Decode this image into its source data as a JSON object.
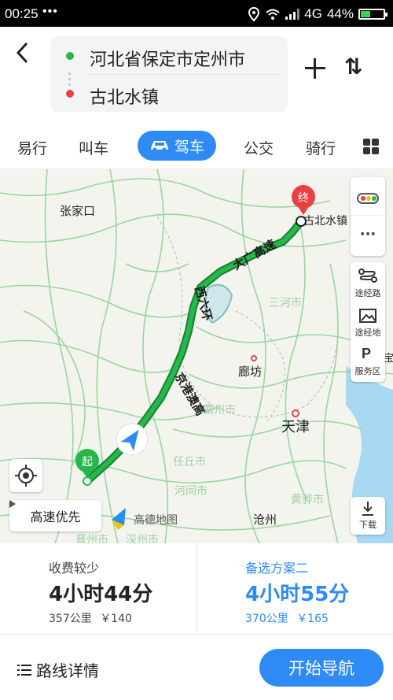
{
  "status": {
    "time": "00:25",
    "dots": "•••",
    "network": "4G",
    "battery": "44%",
    "battery_level": 0.44
  },
  "header": {
    "back_icon": "chevron-left-icon",
    "origin": "河北省保定市定州市",
    "destination": "古北水镇",
    "add_icon": "plus-icon",
    "swap_icon": "swap-icon",
    "swap_glyph": "⇅"
  },
  "modes": {
    "items": [
      "易行",
      "叫车",
      "驾车",
      "公交",
      "骑行"
    ],
    "active": "驾车"
  },
  "map": {
    "labels": {
      "zhangjiakou": "张家口",
      "gubei": "古北水镇",
      "sanhe": "三河市",
      "langfang": "廊坊",
      "bazhou": "霸州市",
      "tianjin": "天津",
      "renqiu": "任丘市",
      "hejian": "河间市",
      "huanghua": "黄骅市",
      "cangzhou": "沧州",
      "jinzhou": "晋州市",
      "shenzhou": "深州市",
      "edge_right": "宝坻",
      "road1": "大广高速",
      "road2": "西六环",
      "road3": "京港澳高"
    },
    "start_badge": "起",
    "end_badge": "终",
    "route_pref": "高速优先",
    "brand": "高德地图",
    "side": {
      "more_dots": "···",
      "waypoint_route": "途经路",
      "waypoint_place": "途经地",
      "service_area": "服务区",
      "download": "下载",
      "service_icon_glyph": "P"
    }
  },
  "plans": {
    "primary": {
      "label": "收费较少",
      "time": "4小时44分",
      "distance": "357公里",
      "toll": "￥140"
    },
    "alternative": {
      "label": "备选方案二",
      "time": "4小时55分",
      "distance": "370公里",
      "toll": "￥165"
    }
  },
  "footer": {
    "details": "路线详情",
    "start": "开始导航"
  },
  "colors": {
    "accent": "#2e8bf5",
    "route": "#27b84b",
    "end_marker": "#e94141",
    "start_marker": "#27b84b"
  }
}
